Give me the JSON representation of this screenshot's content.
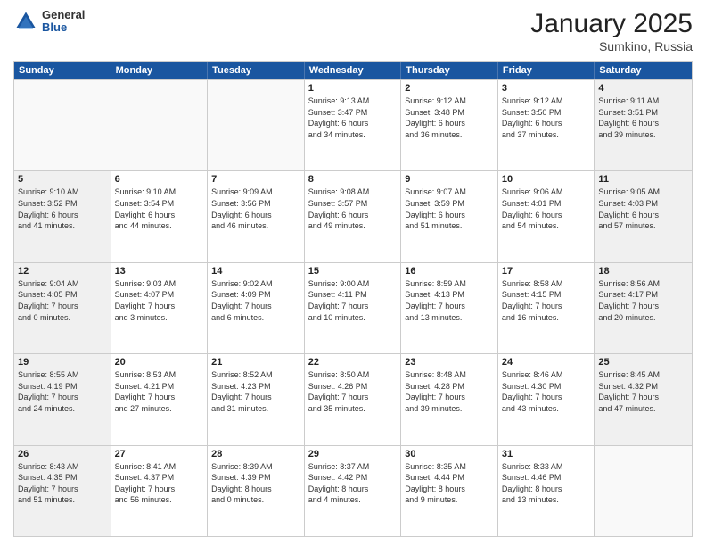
{
  "header": {
    "logo_general": "General",
    "logo_blue": "Blue",
    "month_year": "January 2025",
    "location": "Sumkino, Russia"
  },
  "weekdays": [
    "Sunday",
    "Monday",
    "Tuesday",
    "Wednesday",
    "Thursday",
    "Friday",
    "Saturday"
  ],
  "rows": [
    [
      {
        "day": "",
        "text": "",
        "shaded": false,
        "empty": true
      },
      {
        "day": "",
        "text": "",
        "shaded": false,
        "empty": true
      },
      {
        "day": "",
        "text": "",
        "shaded": false,
        "empty": true
      },
      {
        "day": "1",
        "text": "Sunrise: 9:13 AM\nSunset: 3:47 PM\nDaylight: 6 hours\nand 34 minutes.",
        "shaded": false,
        "empty": false
      },
      {
        "day": "2",
        "text": "Sunrise: 9:12 AM\nSunset: 3:48 PM\nDaylight: 6 hours\nand 36 minutes.",
        "shaded": false,
        "empty": false
      },
      {
        "day": "3",
        "text": "Sunrise: 9:12 AM\nSunset: 3:50 PM\nDaylight: 6 hours\nand 37 minutes.",
        "shaded": false,
        "empty": false
      },
      {
        "day": "4",
        "text": "Sunrise: 9:11 AM\nSunset: 3:51 PM\nDaylight: 6 hours\nand 39 minutes.",
        "shaded": true,
        "empty": false
      }
    ],
    [
      {
        "day": "5",
        "text": "Sunrise: 9:10 AM\nSunset: 3:52 PM\nDaylight: 6 hours\nand 41 minutes.",
        "shaded": true,
        "empty": false
      },
      {
        "day": "6",
        "text": "Sunrise: 9:10 AM\nSunset: 3:54 PM\nDaylight: 6 hours\nand 44 minutes.",
        "shaded": false,
        "empty": false
      },
      {
        "day": "7",
        "text": "Sunrise: 9:09 AM\nSunset: 3:56 PM\nDaylight: 6 hours\nand 46 minutes.",
        "shaded": false,
        "empty": false
      },
      {
        "day": "8",
        "text": "Sunrise: 9:08 AM\nSunset: 3:57 PM\nDaylight: 6 hours\nand 49 minutes.",
        "shaded": false,
        "empty": false
      },
      {
        "day": "9",
        "text": "Sunrise: 9:07 AM\nSunset: 3:59 PM\nDaylight: 6 hours\nand 51 minutes.",
        "shaded": false,
        "empty": false
      },
      {
        "day": "10",
        "text": "Sunrise: 9:06 AM\nSunset: 4:01 PM\nDaylight: 6 hours\nand 54 minutes.",
        "shaded": false,
        "empty": false
      },
      {
        "day": "11",
        "text": "Sunrise: 9:05 AM\nSunset: 4:03 PM\nDaylight: 6 hours\nand 57 minutes.",
        "shaded": true,
        "empty": false
      }
    ],
    [
      {
        "day": "12",
        "text": "Sunrise: 9:04 AM\nSunset: 4:05 PM\nDaylight: 7 hours\nand 0 minutes.",
        "shaded": true,
        "empty": false
      },
      {
        "day": "13",
        "text": "Sunrise: 9:03 AM\nSunset: 4:07 PM\nDaylight: 7 hours\nand 3 minutes.",
        "shaded": false,
        "empty": false
      },
      {
        "day": "14",
        "text": "Sunrise: 9:02 AM\nSunset: 4:09 PM\nDaylight: 7 hours\nand 6 minutes.",
        "shaded": false,
        "empty": false
      },
      {
        "day": "15",
        "text": "Sunrise: 9:00 AM\nSunset: 4:11 PM\nDaylight: 7 hours\nand 10 minutes.",
        "shaded": false,
        "empty": false
      },
      {
        "day": "16",
        "text": "Sunrise: 8:59 AM\nSunset: 4:13 PM\nDaylight: 7 hours\nand 13 minutes.",
        "shaded": false,
        "empty": false
      },
      {
        "day": "17",
        "text": "Sunrise: 8:58 AM\nSunset: 4:15 PM\nDaylight: 7 hours\nand 16 minutes.",
        "shaded": false,
        "empty": false
      },
      {
        "day": "18",
        "text": "Sunrise: 8:56 AM\nSunset: 4:17 PM\nDaylight: 7 hours\nand 20 minutes.",
        "shaded": true,
        "empty": false
      }
    ],
    [
      {
        "day": "19",
        "text": "Sunrise: 8:55 AM\nSunset: 4:19 PM\nDaylight: 7 hours\nand 24 minutes.",
        "shaded": true,
        "empty": false
      },
      {
        "day": "20",
        "text": "Sunrise: 8:53 AM\nSunset: 4:21 PM\nDaylight: 7 hours\nand 27 minutes.",
        "shaded": false,
        "empty": false
      },
      {
        "day": "21",
        "text": "Sunrise: 8:52 AM\nSunset: 4:23 PM\nDaylight: 7 hours\nand 31 minutes.",
        "shaded": false,
        "empty": false
      },
      {
        "day": "22",
        "text": "Sunrise: 8:50 AM\nSunset: 4:26 PM\nDaylight: 7 hours\nand 35 minutes.",
        "shaded": false,
        "empty": false
      },
      {
        "day": "23",
        "text": "Sunrise: 8:48 AM\nSunset: 4:28 PM\nDaylight: 7 hours\nand 39 minutes.",
        "shaded": false,
        "empty": false
      },
      {
        "day": "24",
        "text": "Sunrise: 8:46 AM\nSunset: 4:30 PM\nDaylight: 7 hours\nand 43 minutes.",
        "shaded": false,
        "empty": false
      },
      {
        "day": "25",
        "text": "Sunrise: 8:45 AM\nSunset: 4:32 PM\nDaylight: 7 hours\nand 47 minutes.",
        "shaded": true,
        "empty": false
      }
    ],
    [
      {
        "day": "26",
        "text": "Sunrise: 8:43 AM\nSunset: 4:35 PM\nDaylight: 7 hours\nand 51 minutes.",
        "shaded": true,
        "empty": false
      },
      {
        "day": "27",
        "text": "Sunrise: 8:41 AM\nSunset: 4:37 PM\nDaylight: 7 hours\nand 56 minutes.",
        "shaded": false,
        "empty": false
      },
      {
        "day": "28",
        "text": "Sunrise: 8:39 AM\nSunset: 4:39 PM\nDaylight: 8 hours\nand 0 minutes.",
        "shaded": false,
        "empty": false
      },
      {
        "day": "29",
        "text": "Sunrise: 8:37 AM\nSunset: 4:42 PM\nDaylight: 8 hours\nand 4 minutes.",
        "shaded": false,
        "empty": false
      },
      {
        "day": "30",
        "text": "Sunrise: 8:35 AM\nSunset: 4:44 PM\nDaylight: 8 hours\nand 9 minutes.",
        "shaded": false,
        "empty": false
      },
      {
        "day": "31",
        "text": "Sunrise: 8:33 AM\nSunset: 4:46 PM\nDaylight: 8 hours\nand 13 minutes.",
        "shaded": false,
        "empty": false
      },
      {
        "day": "",
        "text": "",
        "shaded": true,
        "empty": true
      }
    ]
  ]
}
